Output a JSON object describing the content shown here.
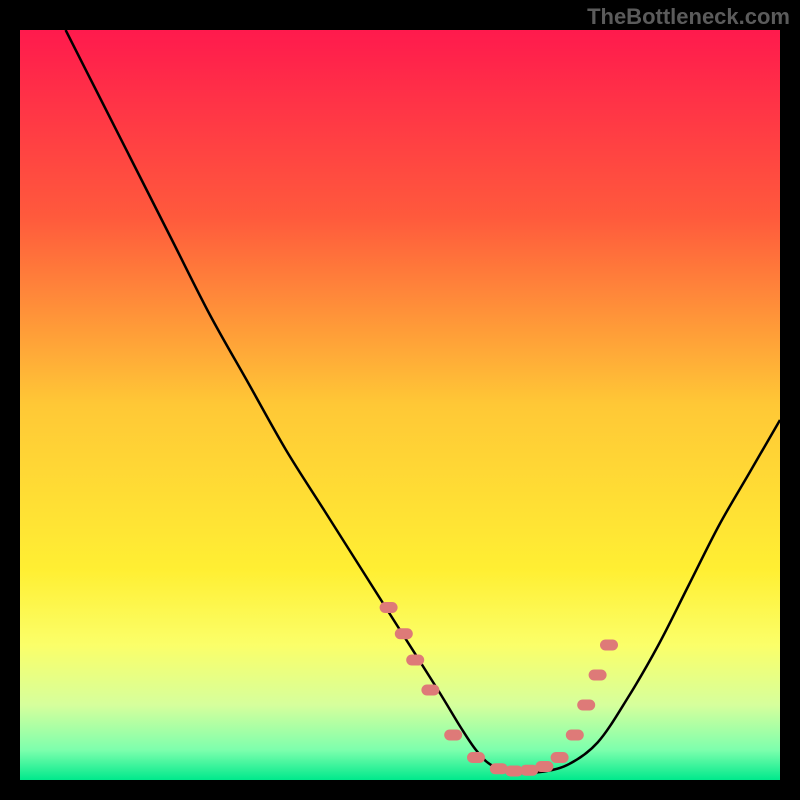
{
  "watermark": "TheBottleneck.com",
  "chart_data": {
    "type": "line",
    "title": "",
    "xlabel": "",
    "ylabel": "",
    "xlim": [
      0,
      100
    ],
    "ylim": [
      0,
      100
    ],
    "gradient_stops": [
      {
        "offset": 0.0,
        "color": "#ff1a4d"
      },
      {
        "offset": 0.25,
        "color": "#ff5a3c"
      },
      {
        "offset": 0.5,
        "color": "#ffc836"
      },
      {
        "offset": 0.72,
        "color": "#ffef33"
      },
      {
        "offset": 0.82,
        "color": "#fbff69"
      },
      {
        "offset": 0.9,
        "color": "#d6ff9c"
      },
      {
        "offset": 0.96,
        "color": "#7dffad"
      },
      {
        "offset": 1.0,
        "color": "#00e98c"
      }
    ],
    "series": [
      {
        "name": "bottleneck-curve",
        "x": [
          6,
          10,
          15,
          20,
          25,
          30,
          35,
          40,
          45,
          50,
          55,
          58,
          60,
          62,
          65,
          68,
          72,
          76,
          80,
          84,
          88,
          92,
          96,
          100
        ],
        "y": [
          100,
          92,
          82,
          72,
          62,
          53,
          44,
          36,
          28,
          20,
          12,
          7,
          4,
          2,
          1,
          1,
          2,
          5,
          11,
          18,
          26,
          34,
          41,
          48
        ]
      }
    ],
    "markers": {
      "name": "highlight-points",
      "color": "#de7a78",
      "x": [
        48.5,
        50.5,
        52,
        54,
        57,
        60,
        63,
        65,
        67,
        69,
        71,
        73,
        74.5,
        76,
        77.5
      ],
      "y": [
        23,
        19.5,
        16,
        12,
        6,
        3,
        1.5,
        1.2,
        1.3,
        1.8,
        3,
        6,
        10,
        14,
        18
      ]
    }
  }
}
